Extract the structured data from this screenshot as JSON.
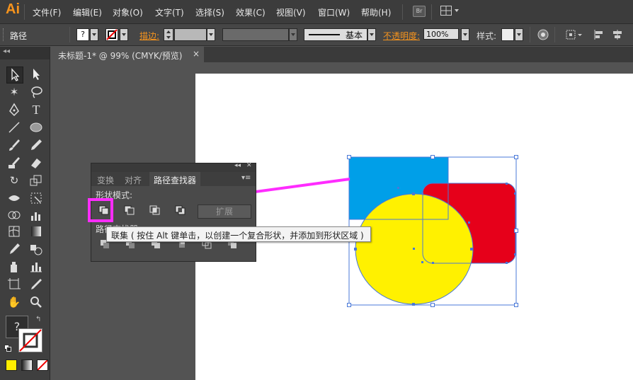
{
  "app": {
    "logo": "Ai"
  },
  "menu": [
    "文件(F)",
    "编辑(E)",
    "对象(O)",
    "文字(T)",
    "选择(S)",
    "效果(C)",
    "视图(V)",
    "窗口(W)",
    "帮助(H)"
  ],
  "bridge_label": "Br",
  "control_bar": {
    "object_type": "路径",
    "fill_value": "?",
    "stroke_label": "描边:",
    "stroke_profile": "基本",
    "opacity_label": "不透明度:",
    "opacity_value": "100%",
    "style_label": "样式:"
  },
  "document_tab": {
    "title": "未标题-1* @ 99% (CMYK/预览)",
    "close": "×"
  },
  "toolbox": {
    "fill_unknown": "?"
  },
  "pathfinder_panel": {
    "tabs": [
      "变换",
      "对齐",
      "路径查找器"
    ],
    "shape_modes_label": "形状模式:",
    "expand_label": "扩展",
    "pathfinders_label": "路径查找器:",
    "collapse": "◂◂",
    "close": "✕"
  },
  "tooltip": "联集 ( 按住 Alt 键单击，以创建一个复合形状，并添加到形状区域 )",
  "colors": {
    "blue_square": "#009fe8",
    "red_square": "#e6001a",
    "yellow_circle": "#fff100",
    "selection": "#4a79d8",
    "highlight": "#ff2cff",
    "accent": "#f7941d"
  }
}
